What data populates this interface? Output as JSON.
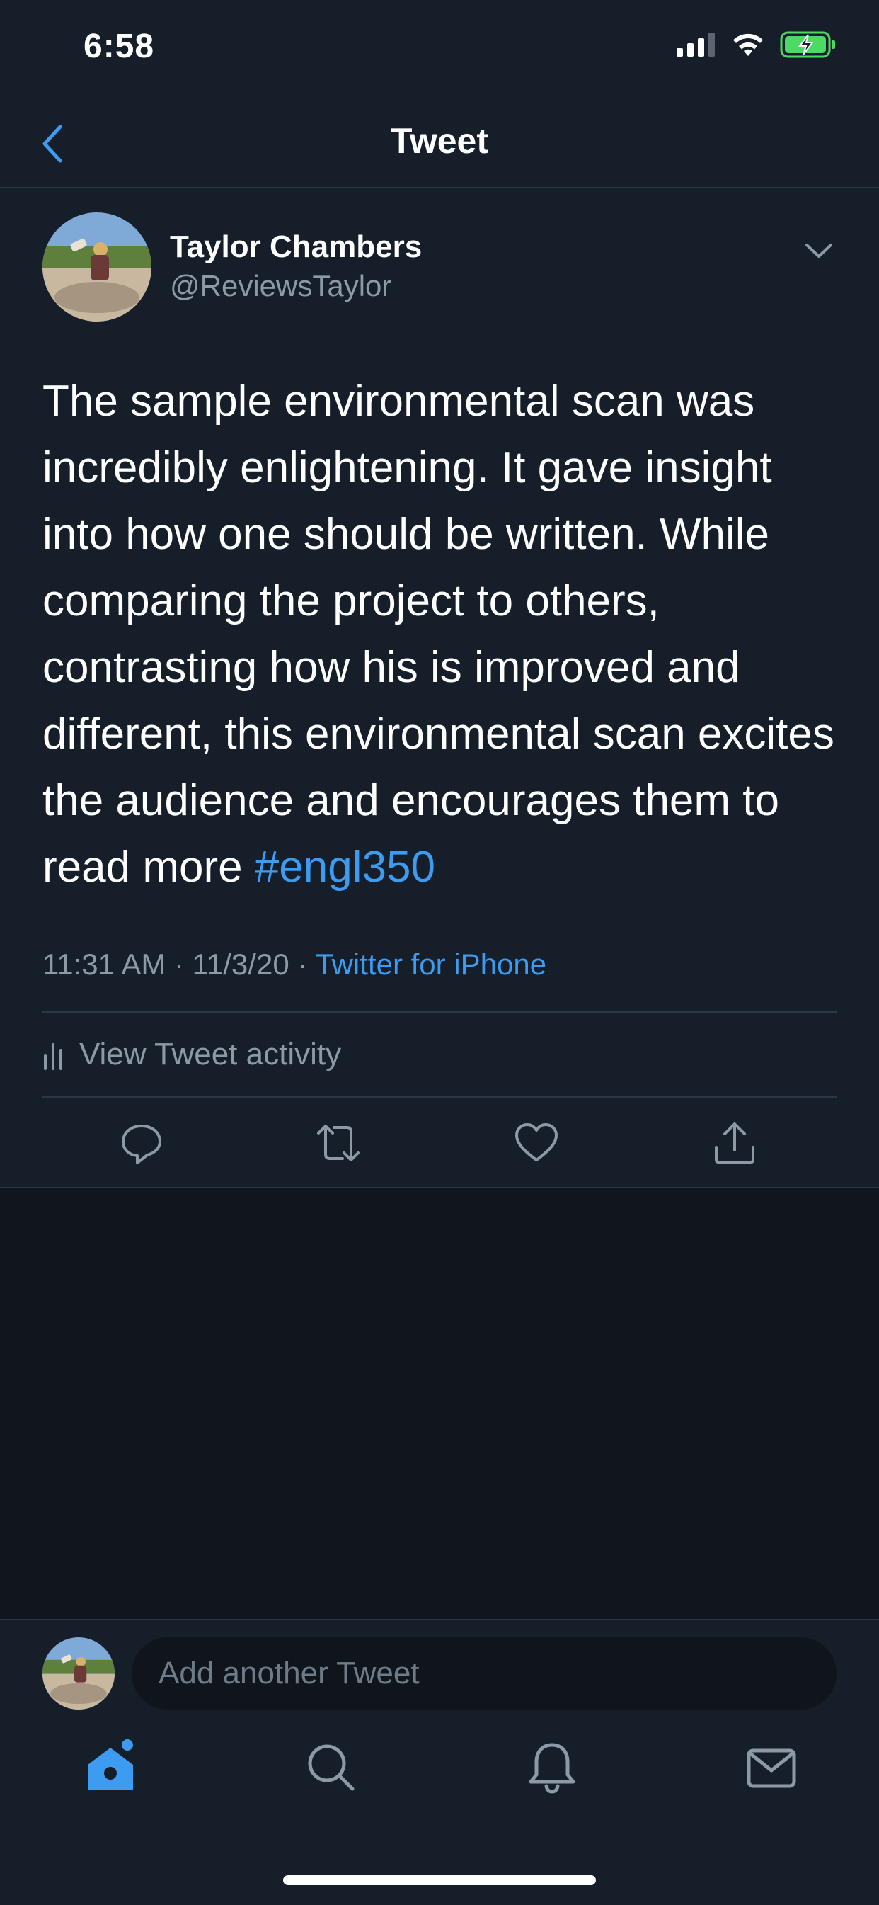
{
  "status_bar": {
    "time": "6:58"
  },
  "nav": {
    "title": "Tweet"
  },
  "tweet": {
    "author_name": "Taylor Chambers",
    "author_handle": "@ReviewsTaylor",
    "text": "The sample environmental scan was incredibly enlightening. It gave insight into how one should be written. While comparing the project to others, contrasting how his is improved and different, this environmental scan excites the audience and encourages them to read more ",
    "hashtag": "#engl350",
    "time": "11:31 AM · 11/3/20 · ",
    "source": "Twitter for iPhone",
    "activity_label": "View Tweet activity"
  },
  "compose": {
    "placeholder": "Add another Tweet"
  },
  "colors": {
    "accent": "#3d9bf0",
    "background": "#161e2a",
    "secondary_text": "#8c99a6",
    "battery": "#4cd964"
  },
  "icons": {
    "back": "chevron-left-icon",
    "menu": "chevron-down-icon",
    "reply": "reply-icon",
    "retweet": "retweet-icon",
    "like": "heart-icon",
    "share": "share-icon",
    "activity": "bar-chart-icon",
    "tabs": [
      "home-icon",
      "search-icon",
      "bell-icon",
      "mail-icon"
    ]
  }
}
